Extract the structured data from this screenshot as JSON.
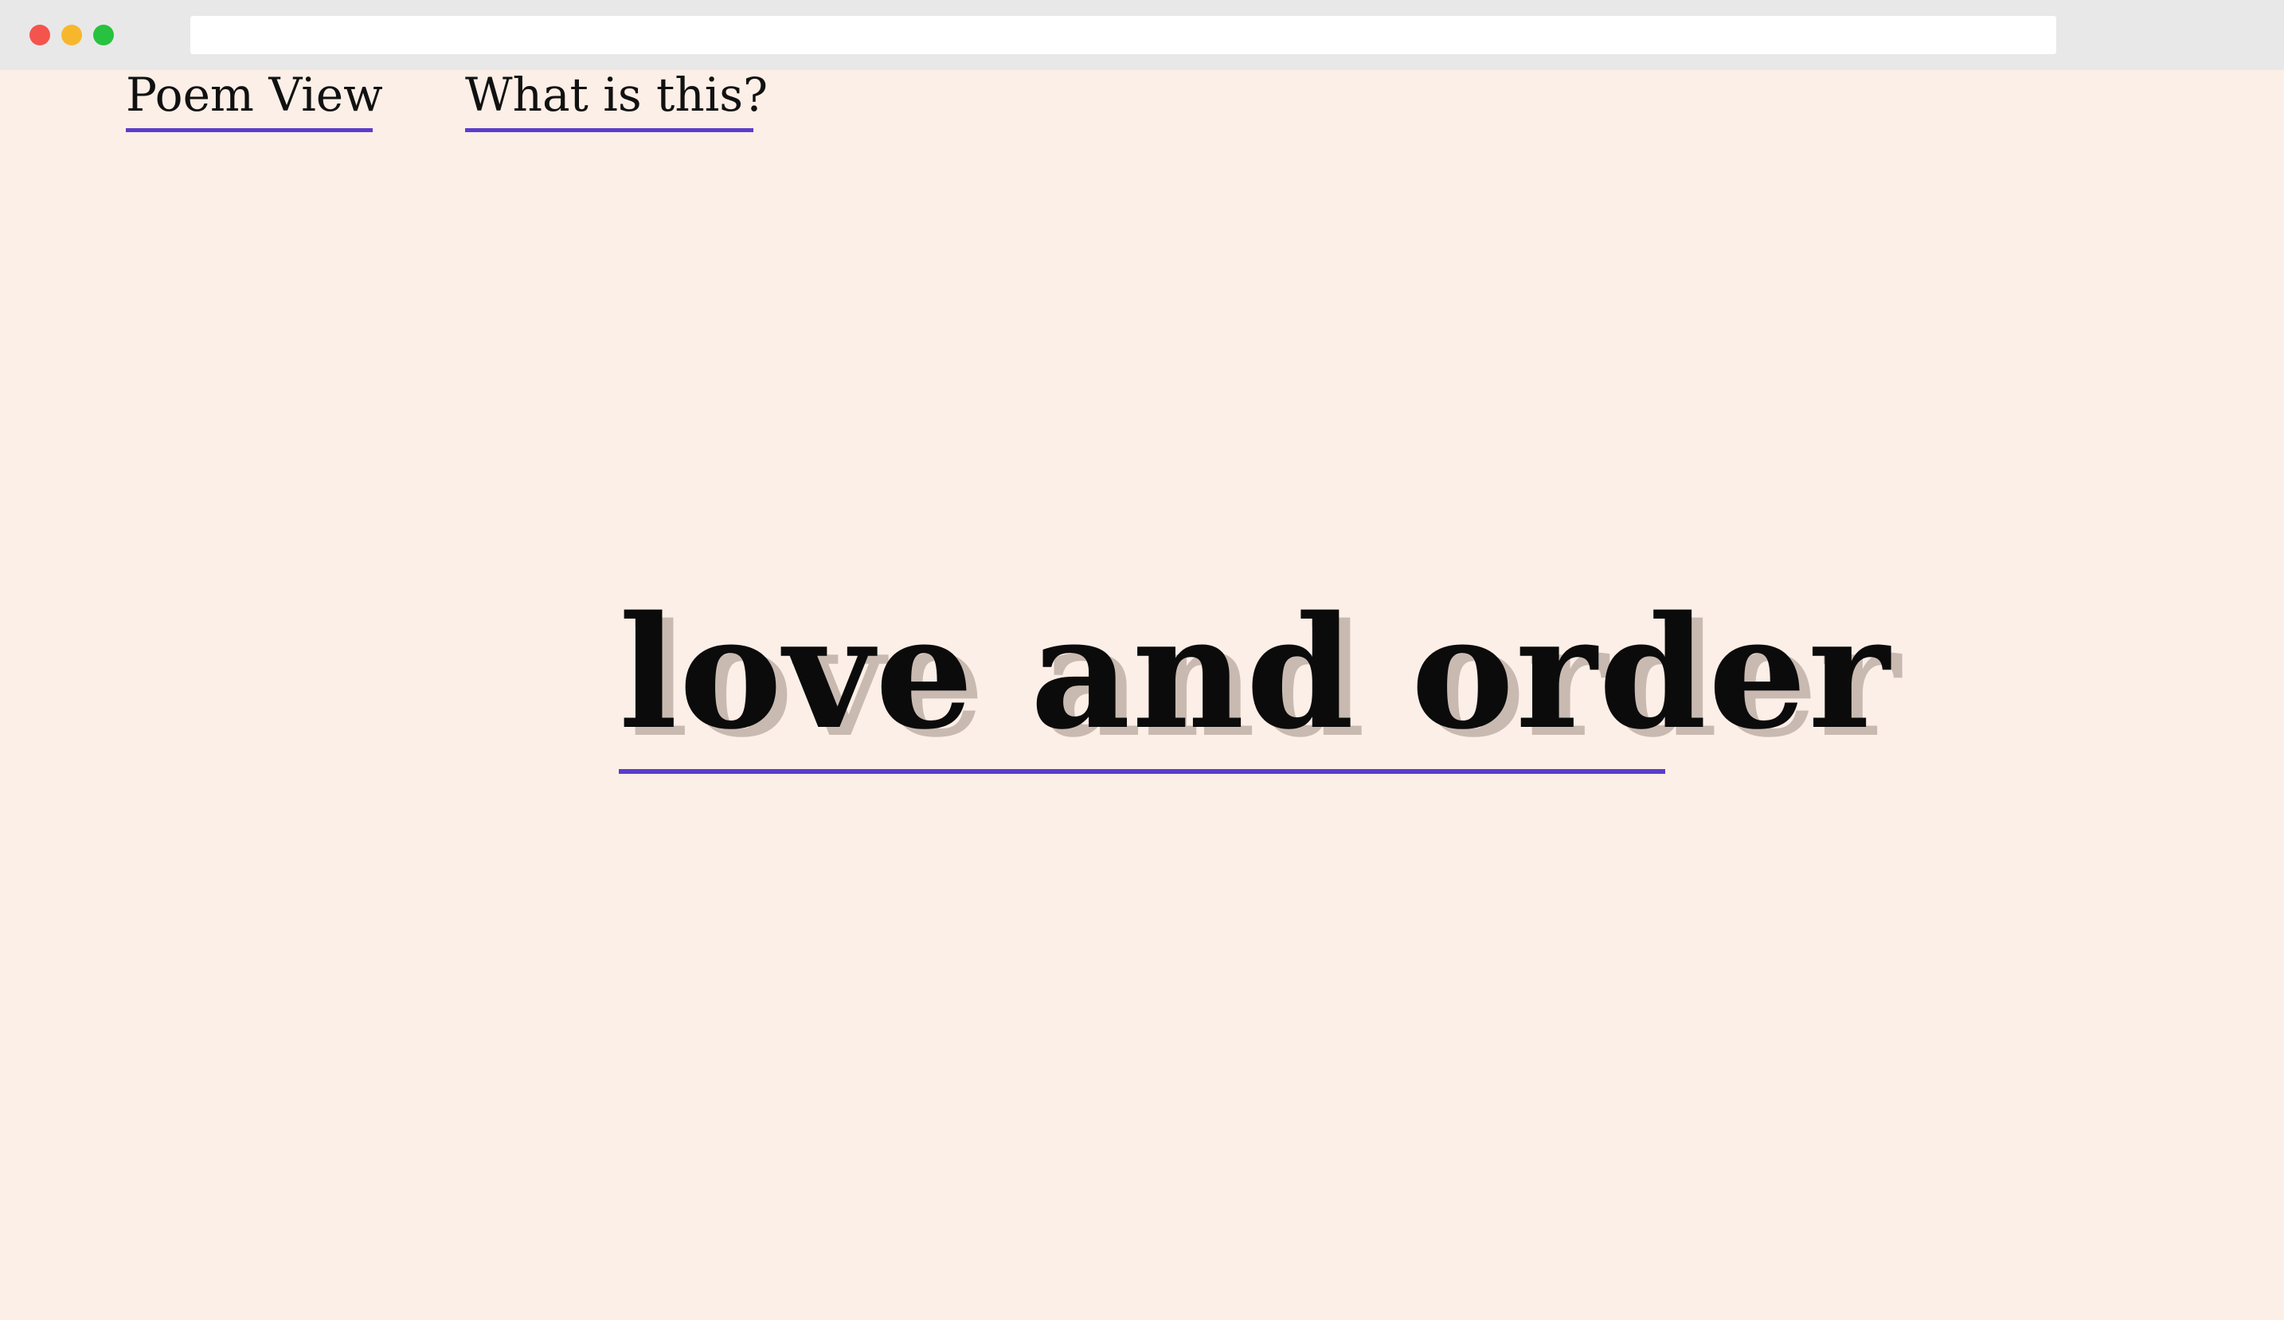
{
  "nav": {
    "poem_view_label": "Poem View",
    "what_is_this_label": "What is this?"
  },
  "main": {
    "title": "love and order"
  },
  "colors": {
    "background": "#fcefe7",
    "accent_underline": "#5b3dcc",
    "text": "#0b0b0b",
    "window_chrome": "#e8e8e8"
  }
}
